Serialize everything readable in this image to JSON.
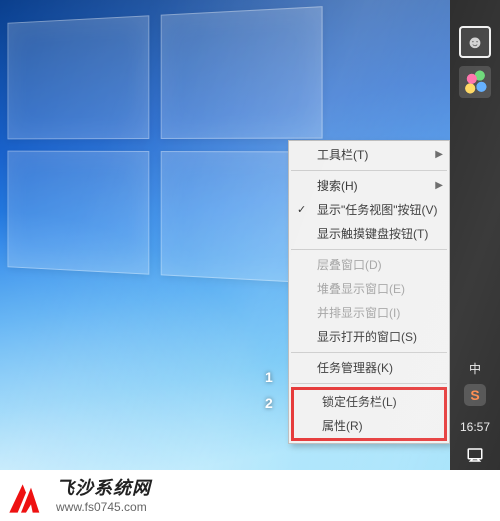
{
  "context_menu": {
    "toolbar": "工具栏(T)",
    "search": "搜索(H)",
    "show_taskview": "显示\"任务视图\"按钮(V)",
    "show_touchkb": "显示触摸键盘按钮(T)",
    "cascade": "层叠窗口(D)",
    "stack": "堆叠显示窗口(E)",
    "sidebyside": "并排显示窗口(I)",
    "show_open": "显示打开的窗口(S)",
    "task_manager": "任务管理器(K)",
    "lock_taskbar": "锁定任务栏(L)",
    "properties": "属性(R)"
  },
  "annotations": {
    "n1": "1",
    "n2": "2"
  },
  "tray": {
    "ime": "中",
    "sogou": "S",
    "clock": "16:57"
  },
  "watermark": {
    "title": "飞沙系统网",
    "url": "www.fs0745.com"
  }
}
